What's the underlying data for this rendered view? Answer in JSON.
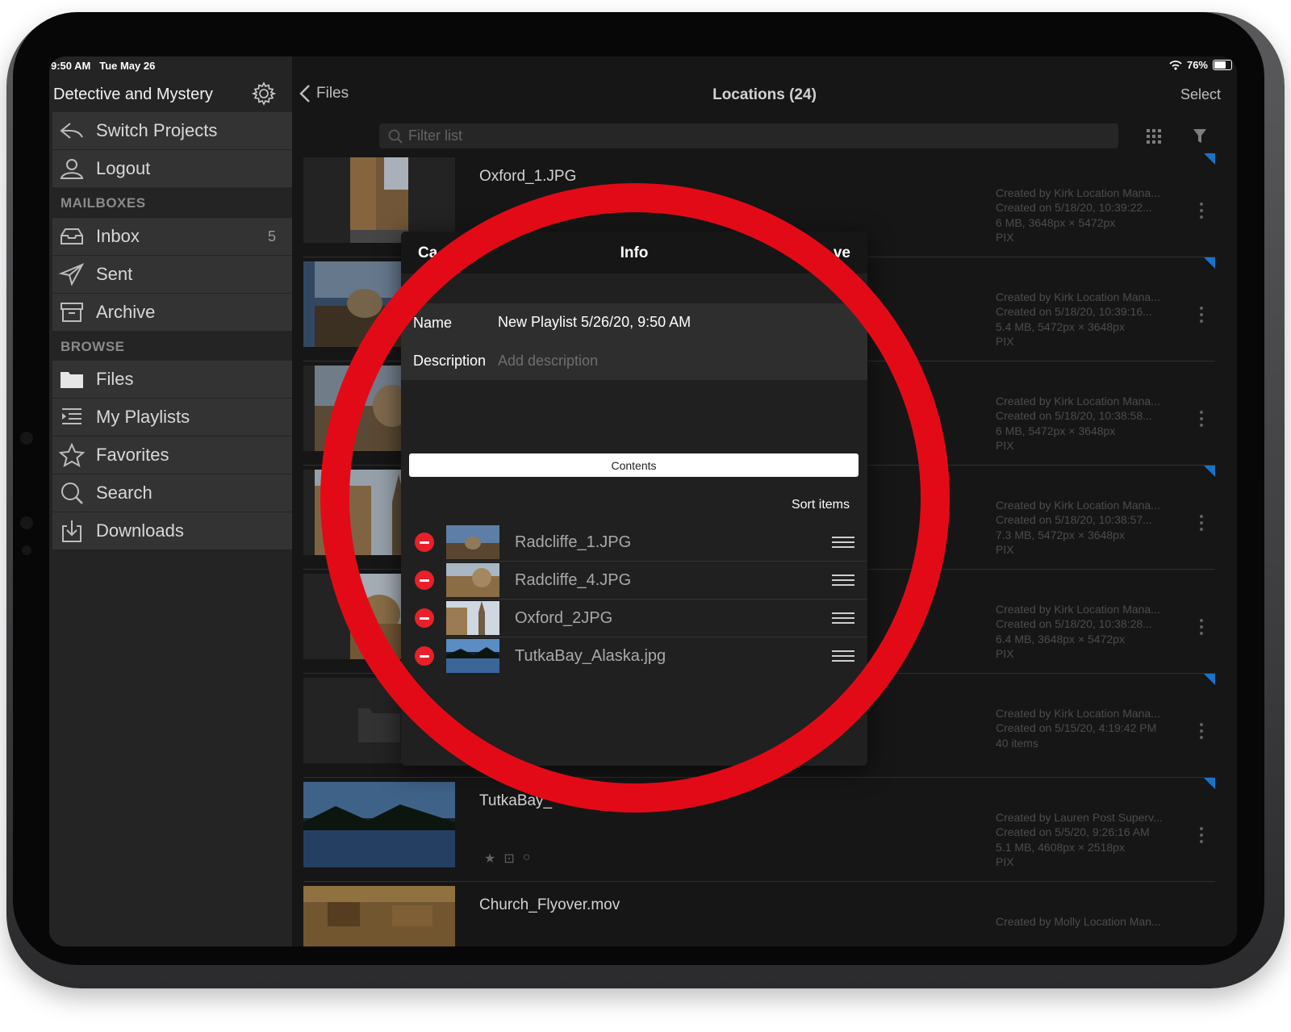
{
  "status": {
    "time": "9:50 AM",
    "date": "Tue May 26",
    "battery": "76%",
    "battery_level": 0.76
  },
  "sidebar": {
    "project_title": "Detective and Mystery",
    "switch_projects": "Switch Projects",
    "logout": "Logout",
    "mailboxes_header": "MAILBOXES",
    "inbox": "Inbox",
    "inbox_count": "5",
    "sent": "Sent",
    "archive": "Archive",
    "browse_header": "BROWSE",
    "files": "Files",
    "my_playlists": "My Playlists",
    "favorites": "Favorites",
    "search": "Search",
    "downloads": "Downloads"
  },
  "nav": {
    "back": "Files",
    "title": "Locations (24)",
    "select": "Select",
    "filter_placeholder": "Filter list"
  },
  "rows": [
    {
      "name": "Oxford_1.JPG",
      "meta": [
        "Created by Kirk Location Mana...",
        "Created on 5/18/20, 10:39:22...",
        "6 MB, 3648px × 5472px",
        "PIX"
      ]
    },
    {
      "name": "",
      "meta": [
        "Created by Kirk Location Mana...",
        "Created on 5/18/20, 10:39:16...",
        "5.4 MB, 5472px × 3648px",
        "PIX"
      ]
    },
    {
      "name": "",
      "meta": [
        "Created by Kirk Location Mana...",
        "Created on 5/18/20, 10:38:58...",
        "6 MB, 5472px × 3648px",
        "PIX"
      ]
    },
    {
      "name": "",
      "meta": [
        "Created by Kirk Location Mana...",
        "Created on 5/18/20, 10:38:57...",
        "7.3 MB, 5472px × 3648px",
        "PIX"
      ]
    },
    {
      "name": "",
      "meta": [
        "Created by Kirk Location Mana...",
        "Created on 5/18/20, 10:38:28...",
        "6.4 MB, 3648px × 5472px",
        "PIX"
      ]
    },
    {
      "name": "",
      "meta": [
        "Created by Kirk Location Mana...",
        "Created on 5/15/20, 4:19:42 PM",
        "40 items",
        ""
      ]
    },
    {
      "name": "TutkaBay_",
      "meta": [
        "Created by Lauren Post Superv...",
        "Created on 5/5/20, 9:26:16 AM",
        "5.1 MB, 4608px × 2518px",
        "PIX"
      ]
    },
    {
      "name": "Church_Flyover.mov",
      "meta": [
        "Created by Molly Location Man...",
        "",
        "",
        ""
      ]
    }
  ],
  "info_panel": {
    "cancel": "Ca",
    "title": "Info",
    "save": "ve",
    "name_label": "Name",
    "name_value": "New Playlist 5/26/20, 9:50 AM",
    "description_label": "Description",
    "description_placeholder": "Add description",
    "contents_button": "Contents",
    "sort_items": "Sort items",
    "items": [
      "Radcliffe_1.JPG",
      "Radcliffe_4.JPG",
      "Oxford_2JPG",
      "TutkaBay_Alaska.jpg"
    ]
  },
  "colors": {
    "highlight_ring": "#e30a17",
    "remove": "#e8202a",
    "accent": "#1e8ef5"
  }
}
